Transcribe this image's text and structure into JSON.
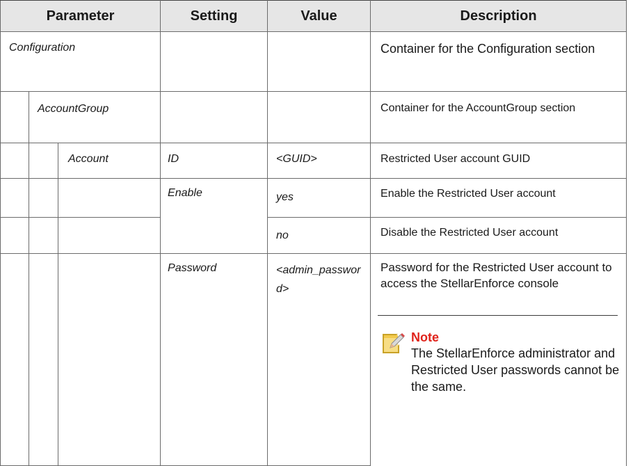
{
  "headers": {
    "parameter": "Parameter",
    "setting": "Setting",
    "value": "Value",
    "description": "Description"
  },
  "rows": {
    "configuration": {
      "param": "Configuration",
      "description": "Container for the Configuration section"
    },
    "account_group": {
      "param": "AccountGroup",
      "description": "Container for the AccountGroup section"
    },
    "account": {
      "param": "Account",
      "id": {
        "setting": "ID",
        "value": "<GUID>",
        "description": "Restricted User account GUID"
      },
      "enable_yes": {
        "setting": "Enable",
        "value": "yes",
        "description": "Enable the Restricted User account"
      },
      "enable_no": {
        "value": "no",
        "description": "Disable the Restricted User account"
      },
      "password": {
        "setting": "Password",
        "value": "<admin_password>",
        "description": "Password for the Restricted User account to access the StellarEnforce console"
      }
    }
  },
  "note": {
    "icon": "note-pencil-icon",
    "title": "Note",
    "text": "The StellarEnforce administrator and Restricted User passwords cannot be the same."
  },
  "colors": {
    "header_bg": "#e6e6e6",
    "border": "#6b6b6b",
    "note_title": "#e0241c",
    "note_icon": "#f2c94c"
  }
}
